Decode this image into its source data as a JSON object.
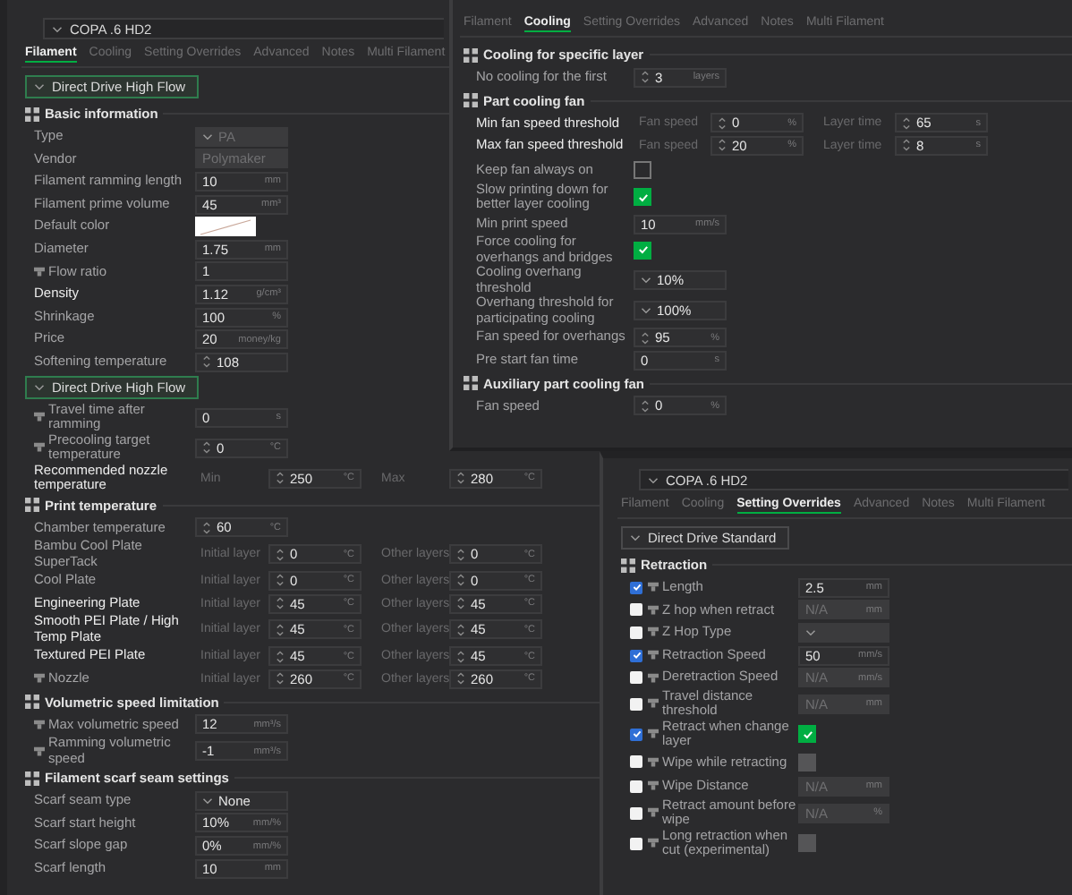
{
  "windows": [
    {
      "kind": "filament",
      "preset": "COPA .6 HD2",
      "tabs": [
        {
          "label": "Filament",
          "selected": true
        },
        {
          "label": "Cooling",
          "selected": false
        },
        {
          "label": "Setting Overrides",
          "selected": false
        },
        {
          "label": "Advanced",
          "selected": false
        },
        {
          "label": "Notes",
          "selected": false
        },
        {
          "label": "Multi Filament",
          "selected": false
        }
      ],
      "blocks": [
        {
          "kind": "variant",
          "label": "Direct Drive High Flow",
          "active": true
        },
        {
          "kind": "section",
          "title": "Basic information"
        },
        {
          "kind": "row",
          "label": "Type",
          "modified": false,
          "fields": [
            {
              "kind": "select",
              "value": "PA",
              "disabled": true
            }
          ]
        },
        {
          "kind": "row",
          "label": "Vendor",
          "modified": false,
          "fields": [
            {
              "kind": "input",
              "value": "Polymaker",
              "disabled": true
            }
          ]
        },
        {
          "kind": "row",
          "label": "Filament ramming length",
          "modified": false,
          "fields": [
            {
              "kind": "input",
              "value": "10",
              "unit": "mm"
            }
          ]
        },
        {
          "kind": "row",
          "label": "Filament prime volume",
          "modified": false,
          "fields": [
            {
              "kind": "input",
              "value": "45",
              "unit": "mm³"
            }
          ]
        },
        {
          "kind": "row",
          "label": "Default color",
          "modified": false,
          "fields": [
            {
              "kind": "color",
              "color": "#ffffff"
            }
          ]
        },
        {
          "kind": "row",
          "label": "Diameter",
          "modified": false,
          "fields": [
            {
              "kind": "input",
              "value": "1.75",
              "unit": "mm"
            }
          ]
        },
        {
          "kind": "row",
          "label": "Flow ratio",
          "modified": false,
          "icon": true,
          "fields": [
            {
              "kind": "input",
              "value": "1"
            }
          ]
        },
        {
          "kind": "row",
          "label": "Density",
          "modified": true,
          "fields": [
            {
              "kind": "input",
              "value": "1.12",
              "unit": "g/cm³"
            }
          ]
        },
        {
          "kind": "row",
          "label": "Shrinkage",
          "modified": false,
          "fields": [
            {
              "kind": "input",
              "value": "100",
              "unit": "%"
            }
          ]
        },
        {
          "kind": "row",
          "label": "Price",
          "modified": false,
          "fields": [
            {
              "kind": "input",
              "value": "20",
              "unit": "money/kg"
            }
          ]
        },
        {
          "kind": "row",
          "label": "Softening temperature",
          "modified": false,
          "fields": [
            {
              "kind": "spin",
              "value": "108"
            }
          ]
        },
        {
          "kind": "variant",
          "label": "Direct Drive High Flow",
          "active": true
        },
        {
          "kind": "row",
          "label": "Travel time after ramming",
          "modified": false,
          "icon": true,
          "fields": [
            {
              "kind": "input",
              "value": "0",
              "unit": "s"
            }
          ]
        },
        {
          "kind": "row",
          "label": "Precooling target temperature",
          "modified": false,
          "icon": true,
          "fields": [
            {
              "kind": "spin",
              "value": "0",
              "unit": "°C"
            }
          ]
        },
        {
          "kind": "row",
          "label": "Recommended nozzle temperature",
          "modified": true,
          "fields": [
            {
              "caption": "Min",
              "kind": "spin",
              "value": "250",
              "unit": "°C"
            },
            {
              "caption": "Max",
              "kind": "spin",
              "value": "280",
              "unit": "°C"
            }
          ]
        },
        {
          "kind": "section",
          "title": "Print temperature"
        },
        {
          "kind": "row",
          "label": "Chamber temperature",
          "modified": false,
          "fields": [
            {
              "kind": "spin",
              "value": "60",
              "unit": "°C"
            }
          ]
        },
        {
          "kind": "row",
          "label": "Bambu Cool Plate SuperTack",
          "modified": false,
          "fields": [
            {
              "caption": "Initial layer",
              "kind": "spin",
              "value": "0",
              "unit": "°C"
            },
            {
              "caption": "Other layers",
              "kind": "spin",
              "value": "0",
              "unit": "°C"
            }
          ]
        },
        {
          "kind": "row",
          "label": "Cool Plate",
          "modified": false,
          "fields": [
            {
              "caption": "Initial layer",
              "kind": "spin",
              "value": "0",
              "unit": "°C"
            },
            {
              "caption": "Other layers",
              "kind": "spin",
              "value": "0",
              "unit": "°C"
            }
          ]
        },
        {
          "kind": "row",
          "label": "Engineering Plate",
          "modified": true,
          "fields": [
            {
              "caption": "Initial layer",
              "kind": "spin",
              "value": "45",
              "unit": "°C"
            },
            {
              "caption": "Other layers",
              "kind": "spin",
              "value": "45",
              "unit": "°C"
            }
          ]
        },
        {
          "kind": "row",
          "label": "Smooth PEI Plate / High Temp Plate",
          "modified": true,
          "fields": [
            {
              "caption": "Initial layer",
              "kind": "spin",
              "value": "45",
              "unit": "°C"
            },
            {
              "caption": "Other layers",
              "kind": "spin",
              "value": "45",
              "unit": "°C"
            }
          ]
        },
        {
          "kind": "row",
          "label": "Textured PEI Plate",
          "modified": true,
          "fields": [
            {
              "caption": "Initial layer",
              "kind": "spin",
              "value": "45",
              "unit": "°C"
            },
            {
              "caption": "Other layers",
              "kind": "spin",
              "value": "45",
              "unit": "°C"
            }
          ]
        },
        {
          "kind": "row",
          "label": "Nozzle",
          "modified": false,
          "icon": true,
          "fields": [
            {
              "caption": "Initial layer",
              "kind": "spin",
              "value": "260",
              "unit": "°C"
            },
            {
              "caption": "Other layers",
              "kind": "spin",
              "value": "260",
              "unit": "°C"
            }
          ]
        },
        {
          "kind": "section",
          "title": "Volumetric speed limitation"
        },
        {
          "kind": "row",
          "label": "Max volumetric speed",
          "modified": false,
          "icon": true,
          "fields": [
            {
              "kind": "input",
              "value": "12",
              "unit": "mm³/s"
            }
          ]
        },
        {
          "kind": "row",
          "label": "Ramming volumetric speed",
          "modified": false,
          "icon": true,
          "fields": [
            {
              "kind": "input",
              "value": "-1",
              "unit": "mm³/s"
            }
          ]
        },
        {
          "kind": "section",
          "title": "Filament scarf seam settings"
        },
        {
          "kind": "row",
          "label": "Scarf seam type",
          "modified": false,
          "fields": [
            {
              "kind": "select",
              "value": "None"
            }
          ]
        },
        {
          "kind": "row",
          "label": "Scarf start height",
          "modified": false,
          "fields": [
            {
              "kind": "input",
              "value": "10%",
              "unit": "mm/%"
            }
          ]
        },
        {
          "kind": "row",
          "label": "Scarf slope gap",
          "modified": false,
          "fields": [
            {
              "kind": "input",
              "value": "0%",
              "unit": "mm/%"
            }
          ]
        },
        {
          "kind": "row",
          "label": "Scarf length",
          "modified": false,
          "fields": [
            {
              "kind": "input",
              "value": "10",
              "unit": "mm"
            }
          ]
        }
      ]
    },
    {
      "kind": "cooling",
      "tabs": [
        {
          "label": "Filament",
          "selected": false
        },
        {
          "label": "Cooling",
          "selected": true
        },
        {
          "label": "Setting Overrides",
          "selected": false
        },
        {
          "label": "Advanced",
          "selected": false
        },
        {
          "label": "Notes",
          "selected": false
        },
        {
          "label": "Multi Filament",
          "selected": false
        }
      ],
      "blocks": [
        {
          "kind": "section",
          "title": "Cooling for specific layer"
        },
        {
          "kind": "row",
          "label": "No cooling for the first",
          "modified": false,
          "fields": [
            {
              "kind": "spin",
              "value": "3",
              "unit": "layers"
            }
          ]
        },
        {
          "kind": "section",
          "title": "Part cooling fan"
        },
        {
          "kind": "row",
          "label": "Min fan speed threshold",
          "modified": true,
          "fields": [
            {
              "caption": "Fan speed",
              "kind": "spin",
              "value": "0",
              "unit": "%"
            },
            {
              "caption": "Layer time",
              "kind": "spin",
              "value": "65",
              "unit": "s"
            }
          ]
        },
        {
          "kind": "row",
          "label": "Max fan speed threshold",
          "modified": true,
          "fields": [
            {
              "caption": "Fan speed",
              "kind": "spin",
              "value": "20",
              "unit": "%"
            },
            {
              "caption": "Layer time",
              "kind": "spin",
              "value": "8",
              "unit": "s"
            }
          ]
        },
        {
          "kind": "row",
          "label": "Keep fan always on",
          "modified": false,
          "fields": [
            {
              "kind": "check",
              "checked": false
            }
          ]
        },
        {
          "kind": "row",
          "label": "Slow printing down for better layer cooling",
          "modified": false,
          "fields": [
            {
              "kind": "check",
              "checked": true
            }
          ]
        },
        {
          "kind": "row",
          "label": "Min print speed",
          "modified": false,
          "fields": [
            {
              "kind": "input",
              "value": "10",
              "unit": "mm/s"
            }
          ]
        },
        {
          "kind": "row",
          "label": "Force cooling for overhangs and bridges",
          "modified": false,
          "fields": [
            {
              "kind": "check",
              "checked": true
            }
          ]
        },
        {
          "kind": "row",
          "label": "Cooling overhang threshold",
          "modified": false,
          "fields": [
            {
              "kind": "select",
              "value": "10%"
            }
          ]
        },
        {
          "kind": "row",
          "label": "Overhang threshold for participating cooling",
          "modified": false,
          "fields": [
            {
              "kind": "select",
              "value": "100%"
            }
          ]
        },
        {
          "kind": "row",
          "label": "Fan speed for overhangs",
          "modified": false,
          "fields": [
            {
              "kind": "spin",
              "value": "95",
              "unit": "%"
            }
          ]
        },
        {
          "kind": "row",
          "label": "Pre start fan time",
          "modified": false,
          "fields": [
            {
              "kind": "input",
              "value": "0",
              "unit": "s"
            }
          ]
        },
        {
          "kind": "section",
          "title": "Auxiliary part cooling fan"
        },
        {
          "kind": "row",
          "label": "Fan speed",
          "modified": false,
          "fields": [
            {
              "kind": "spin",
              "value": "0",
              "unit": "%"
            }
          ]
        }
      ]
    },
    {
      "kind": "overrides",
      "preset": "COPA .6 HD2",
      "tabs": [
        {
          "label": "Filament",
          "selected": false
        },
        {
          "label": "Cooling",
          "selected": false
        },
        {
          "label": "Setting Overrides",
          "selected": true
        },
        {
          "label": "Advanced",
          "selected": false
        },
        {
          "label": "Notes",
          "selected": false
        },
        {
          "label": "Multi Filament",
          "selected": false
        }
      ],
      "blocks": [
        {
          "kind": "variant",
          "label": "Direct Drive Standard",
          "active": false
        },
        {
          "kind": "section",
          "title": "Retraction"
        },
        {
          "kind": "row",
          "label": "Length",
          "override": true,
          "modified": false,
          "icon": true,
          "fields": [
            {
              "kind": "input",
              "value": "2.5",
              "unit": "mm"
            }
          ]
        },
        {
          "kind": "row",
          "label": "Z hop when retract",
          "override": false,
          "modified": false,
          "icon": true,
          "fields": [
            {
              "kind": "input",
              "value": "N/A",
              "unit": "mm",
              "disabled": true
            }
          ]
        },
        {
          "kind": "row",
          "label": "Z Hop Type",
          "override": false,
          "modified": false,
          "icon": true,
          "fields": [
            {
              "kind": "select",
              "disabled": true
            }
          ]
        },
        {
          "kind": "row",
          "label": "Retraction Speed",
          "override": true,
          "modified": false,
          "icon": true,
          "fields": [
            {
              "kind": "input",
              "value": "50",
              "unit": "mm/s"
            }
          ]
        },
        {
          "kind": "row",
          "label": "Deretraction Speed",
          "override": false,
          "modified": false,
          "icon": true,
          "fields": [
            {
              "kind": "input",
              "value": "N/A",
              "unit": "mm/s",
              "disabled": true
            }
          ]
        },
        {
          "kind": "row",
          "label": "Travel distance threshold",
          "override": false,
          "modified": false,
          "icon": true,
          "fields": [
            {
              "kind": "input",
              "value": "N/A",
              "unit": "mm",
              "disabled": true
            }
          ]
        },
        {
          "kind": "row",
          "label": "Retract when change layer",
          "override": true,
          "modified": false,
          "icon": true,
          "fields": [
            {
              "kind": "check",
              "checked": true
            }
          ]
        },
        {
          "kind": "row",
          "label": "Wipe while retracting",
          "override": false,
          "modified": false,
          "icon": true,
          "fields": [
            {
              "kind": "check",
              "checked": false,
              "disabled": true
            }
          ]
        },
        {
          "kind": "row",
          "label": "Wipe Distance",
          "override": false,
          "modified": false,
          "icon": true,
          "fields": [
            {
              "kind": "input",
              "value": "N/A",
              "unit": "mm",
              "disabled": true
            }
          ]
        },
        {
          "kind": "row",
          "label": "Retract amount before wipe",
          "override": false,
          "modified": false,
          "icon": true,
          "fields": [
            {
              "kind": "input",
              "value": "N/A",
              "unit": "%",
              "disabled": true
            }
          ]
        },
        {
          "kind": "row",
          "label": "Long retraction when cut (experimental)",
          "override": false,
          "modified": false,
          "icon": true,
          "fields": [
            {
              "kind": "check",
              "checked": false,
              "disabled": true
            }
          ]
        }
      ]
    }
  ]
}
